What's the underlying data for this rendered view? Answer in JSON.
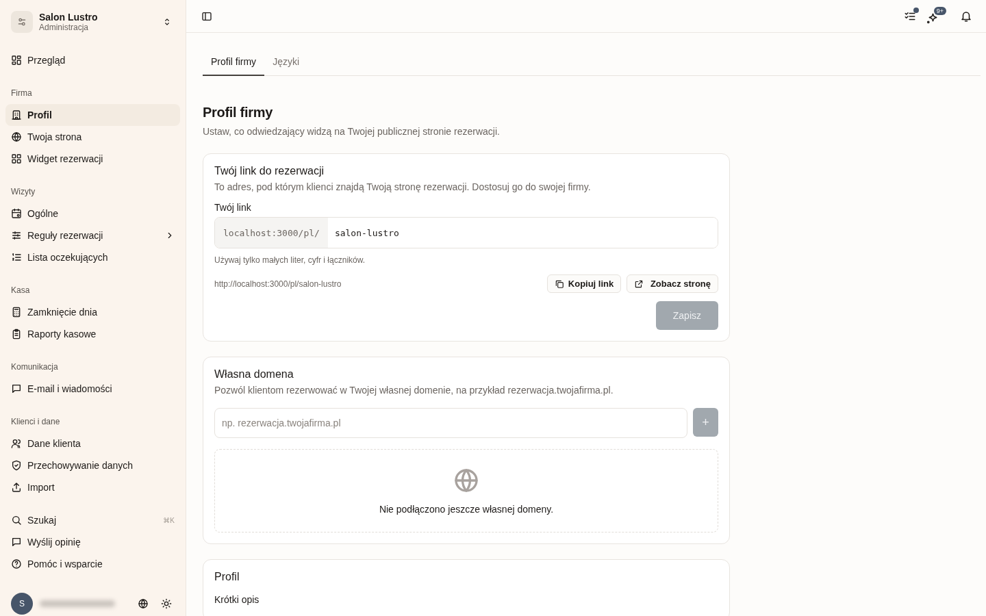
{
  "workspace": {
    "name": "Salon Lustro",
    "role": "Administracja"
  },
  "sidebar": {
    "sections": [
      {
        "items": [
          {
            "label": "Przegląd",
            "selected": false,
            "has_submenu": false
          }
        ]
      },
      {
        "heading": "Firma",
        "items": [
          {
            "label": "Profil",
            "selected": true,
            "has_submenu": false
          },
          {
            "label": "Twoja strona",
            "selected": false,
            "has_submenu": false
          },
          {
            "label": "Widget rezerwacji",
            "selected": false,
            "has_submenu": false
          }
        ]
      },
      {
        "heading": "Wizyty",
        "items": [
          {
            "label": "Ogólne",
            "selected": false,
            "has_submenu": false
          },
          {
            "label": "Reguły rezerwacji",
            "selected": false,
            "has_submenu": true
          },
          {
            "label": "Lista oczekujących",
            "selected": false,
            "has_submenu": false
          }
        ]
      },
      {
        "heading": "Kasa",
        "items": [
          {
            "label": "Zamknięcie dnia",
            "selected": false,
            "has_submenu": false
          },
          {
            "label": "Raporty kasowe",
            "selected": false,
            "has_submenu": false
          }
        ]
      },
      {
        "heading": "Komunikacja",
        "items": [
          {
            "label": "E-mail i wiadomości",
            "selected": false,
            "has_submenu": false
          }
        ]
      },
      {
        "heading": "Klienci i dane",
        "items": [
          {
            "label": "Dane klienta",
            "selected": false,
            "has_submenu": false
          },
          {
            "label": "Przechowywanie danych",
            "selected": false,
            "has_submenu": false
          },
          {
            "label": "Import",
            "selected": false,
            "has_submenu": false
          }
        ]
      },
      {
        "items": [
          {
            "label": "Szukaj",
            "selected": false,
            "has_submenu": false,
            "shortcut": "⌘K"
          },
          {
            "label": "Wyślij opinię",
            "selected": false,
            "has_submenu": false
          },
          {
            "label": "Pomóc i wsparcie",
            "selected": false,
            "has_submenu": false
          }
        ]
      }
    ]
  },
  "user": {
    "initial": "S"
  },
  "topbar": {
    "tasks_unread": true,
    "notes_badge": "9+"
  },
  "tabs": [
    {
      "label": "Profil firmy",
      "selected": true
    },
    {
      "label": "Języki",
      "selected": false
    }
  ],
  "page": {
    "title": "Profil firmy",
    "subtitle": "Ustaw, co odwiedzający widzą na Twojej publicznej stronie rezerwacji."
  },
  "link_card": {
    "title": "Twój link do rezerwacji",
    "description": "To adres, pod którym klienci znajdą Twoją stronę rezerwacji. Dostosuj go do swojej firmy.",
    "field_label": "Twój link",
    "prefix": "localhost:3000/pl/",
    "value": "salon-lustro",
    "hint": "Używaj tylko małych liter, cyfr i łączników.",
    "url": "http://localhost:3000/pl/salon-lustro",
    "copy_button": "Kopiuj link",
    "view_button": "Zobacz stronę",
    "save_button": {
      "label": "Zapisz",
      "disabled": true
    }
  },
  "domain_card": {
    "title": "Własna domena",
    "description": "Pozwól klientom rezerwować w Twojej własnej domenie, na przykład rezerwacja.twojafirma.pl.",
    "placeholder": "np. rezerwacja.twojafirma.pl",
    "add_button": {
      "label": "+",
      "disabled": true
    },
    "empty_text": "Nie podłączono jeszcze własnej domeny."
  },
  "profile_card": {
    "title": "Profil",
    "field_label": "Krótki opis"
  }
}
